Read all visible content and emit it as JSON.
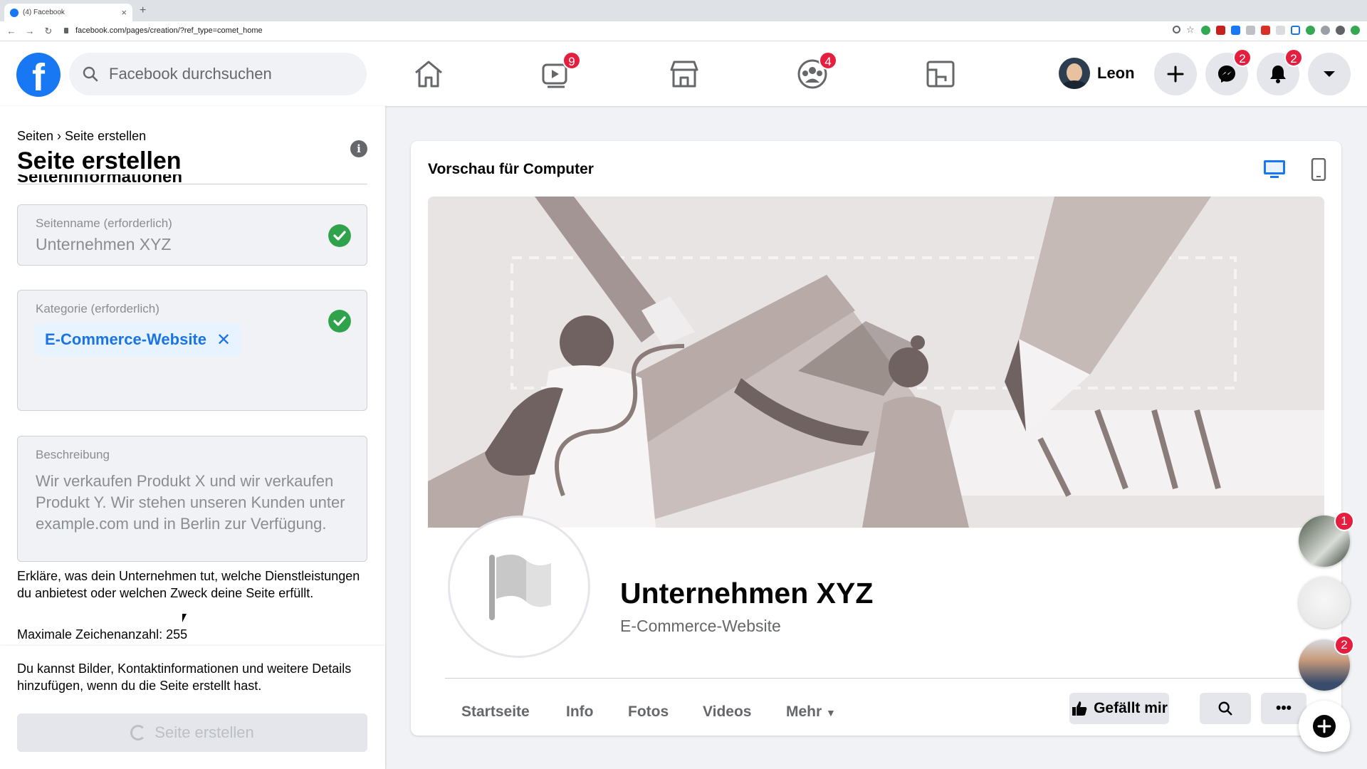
{
  "browser": {
    "tab_title": "(4) Facebook",
    "tab_close": "×",
    "new_tab": "+",
    "url": "facebook.com/pages/creation/?ref_type=comet_home"
  },
  "header": {
    "logo": "f",
    "search_placeholder": "Facebook durchsuchen",
    "watch_badge": "9",
    "groups_badge": "4",
    "profile_name": "Leon",
    "messenger_badge": "2",
    "notifications_badge": "2"
  },
  "left_panel": {
    "breadcrumb": "Seiten › Seite erstellen",
    "title": "Seite erstellen",
    "section_heading": "Seiteninformationen",
    "name_label": "Seitenname (erforderlich)",
    "name_value": "Unternehmen XYZ",
    "category_label": "Kategorie (erforderlich)",
    "category_chip": "E-Commerce-Website",
    "chip_remove": "✕",
    "description_label": "Beschreibung",
    "description_value": "Wir verkaufen Produkt X und wir verkaufen Produkt Y. Wir stehen unseren Kunden unter example.com und in Berlin zur Verfügung.",
    "helper": "Erkläre, was dein Unternehmen tut, welche Dienstleistungen du anbietest oder welchen Zweck deine Seite erfüllt.",
    "max_chars": "Maximale Zeichenanzahl: 255",
    "footer_text": "Du kannst Bilder, Kontaktinformationen und weitere Details hinzufügen, wenn du die Seite erstellt hast.",
    "create_button": "Seite erstellen"
  },
  "preview": {
    "title": "Vorschau für Computer",
    "page_name": "Unternehmen XYZ",
    "page_category": "E-Commerce-Website",
    "tabs": [
      "Startseite",
      "Info",
      "Fotos",
      "Videos",
      "Mehr"
    ],
    "like_button": "Gefällt mir",
    "more_button": "•••"
  },
  "chat_heads": {
    "badge_1": "1",
    "badge_3": "2"
  },
  "colors": {
    "brand": "#1877f2",
    "badge": "#e41e3f",
    "check": "#31a24c"
  }
}
